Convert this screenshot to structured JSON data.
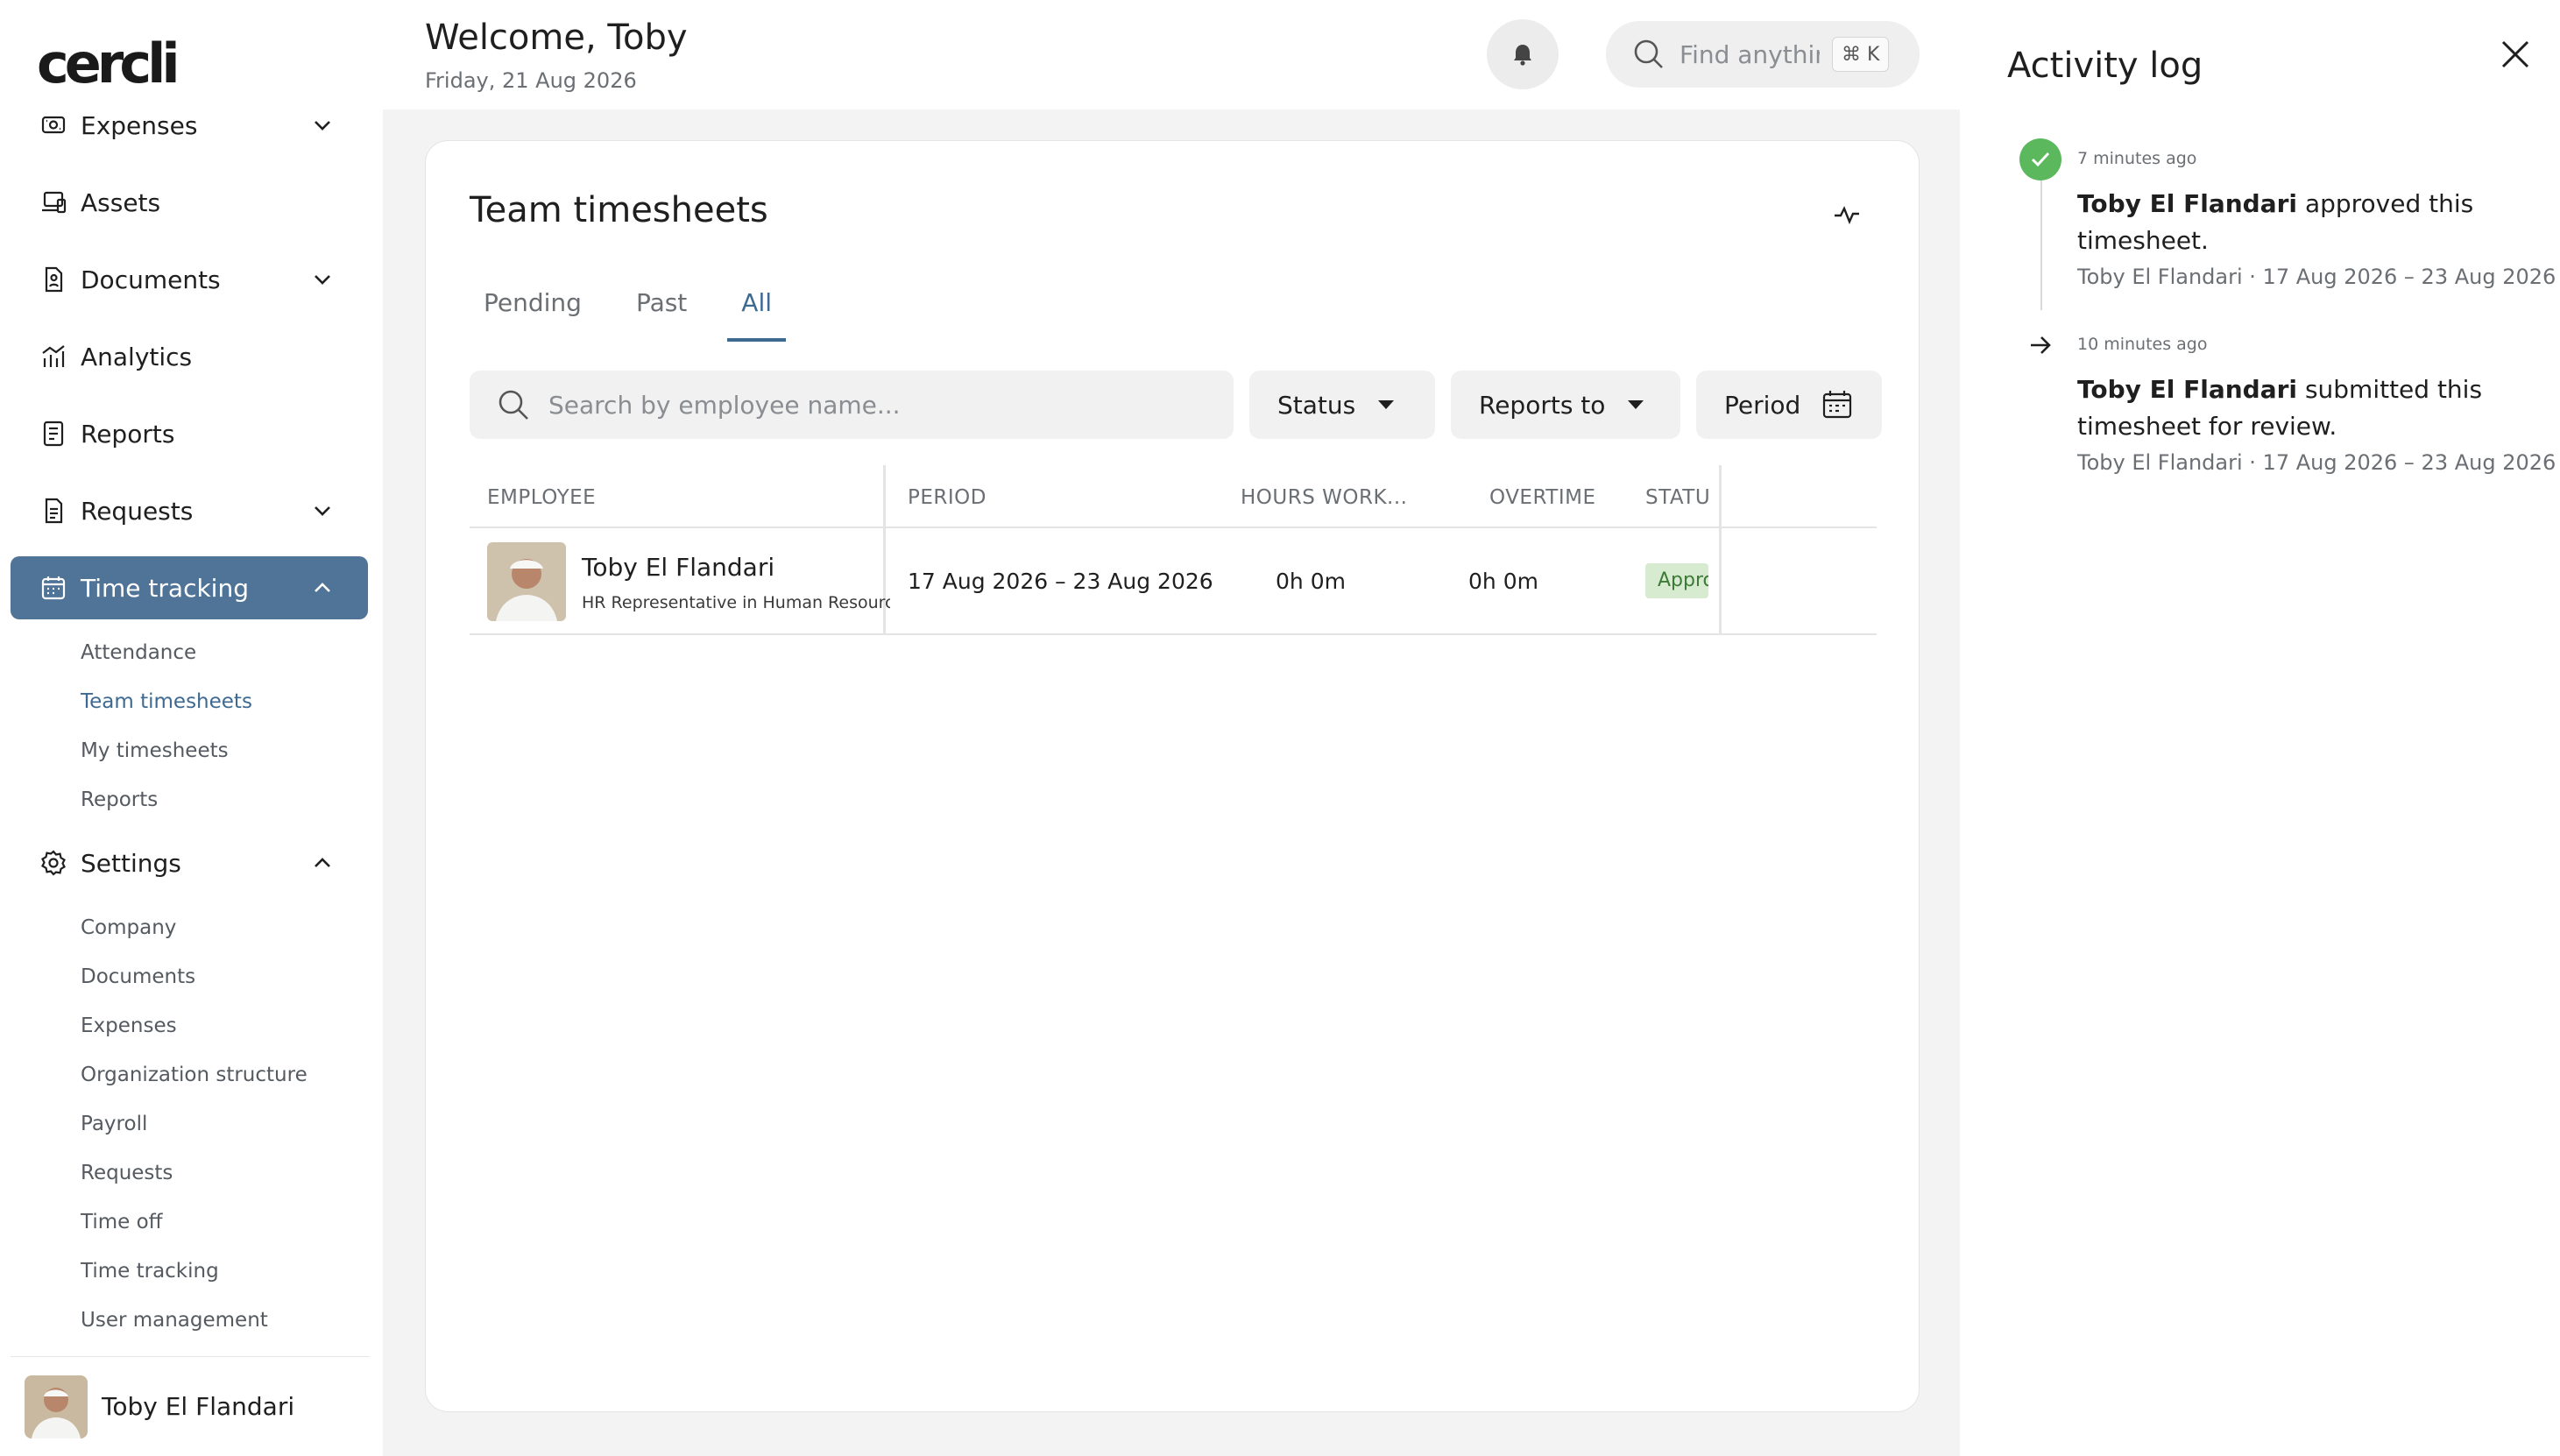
{
  "app": {
    "logo": "cercli"
  },
  "sidebar": {
    "items": [
      {
        "label": "Expenses",
        "icon": "receipt-icon",
        "has_chevron": true,
        "expanded": false
      },
      {
        "label": "Assets",
        "icon": "laptop-icon"
      },
      {
        "label": "Documents",
        "icon": "document-icon",
        "has_chevron": true,
        "expanded": false
      },
      {
        "label": "Analytics",
        "icon": "analytics-icon"
      },
      {
        "label": "Reports",
        "icon": "report-icon"
      },
      {
        "label": "Requests",
        "icon": "request-icon",
        "has_chevron": true,
        "expanded": false
      },
      {
        "label": "Time tracking",
        "icon": "calendar-icon",
        "has_chevron": true,
        "expanded": true,
        "active": true
      },
      {
        "label": "Settings",
        "icon": "gear-icon",
        "has_chevron": true,
        "expanded": true
      }
    ],
    "time_tracking_sub": [
      "Attendance",
      "Team timesheets",
      "My timesheets",
      "Reports"
    ],
    "time_tracking_active": "Team timesheets",
    "settings_sub": [
      "Company",
      "Documents",
      "Expenses",
      "Organization structure",
      "Payroll",
      "Requests",
      "Time off",
      "Time tracking",
      "User management"
    ],
    "user": {
      "name": "Toby El Flandari"
    }
  },
  "header": {
    "welcome": "Welcome, Toby",
    "date": "Friday, 21 Aug 2026",
    "search_placeholder": "Find anythir",
    "shortcut": "⌘ K"
  },
  "main": {
    "title": "Team timesheets",
    "tabs": [
      "Pending",
      "Past",
      "All"
    ],
    "active_tab": "All",
    "search_placeholder": "Search by employee name...",
    "filters": {
      "status": "Status",
      "reports_to": "Reports to",
      "period": "Period"
    },
    "columns": [
      "EMPLOYEE",
      "PERIOD",
      "HOURS WORK...",
      "OVERTIME",
      "STATU"
    ],
    "rows": [
      {
        "name": "Toby El Flandari",
        "role": "HR Representative in Human Resources",
        "period": "17 Aug 2026 – 23 Aug 2026",
        "hours": "0h 0m",
        "overtime": "0h 0m",
        "status": "Appro"
      }
    ]
  },
  "activity": {
    "title": "Activity log",
    "events": [
      {
        "ago": "7 minutes ago",
        "actor": "Toby El Flandari",
        "action": "approved this timesheet.",
        "meta": "Toby El Flandari · 17 Aug 2026 – 23 Aug 2026",
        "icon": "check-icon",
        "icon_color": "#5cb85c"
      },
      {
        "ago": "10 minutes ago",
        "actor": "Toby El Flandari",
        "action": "submitted this timesheet for review.",
        "meta": "Toby El Flandari · 17 Aug 2026 – 23 Aug 2026",
        "icon": "arrow-right-icon"
      }
    ]
  },
  "colors": {
    "accent": "#4f7497",
    "tab_active": "#3e6a91",
    "approved_bg": "#d6ebcf",
    "approved_text": "#3d7a35"
  }
}
